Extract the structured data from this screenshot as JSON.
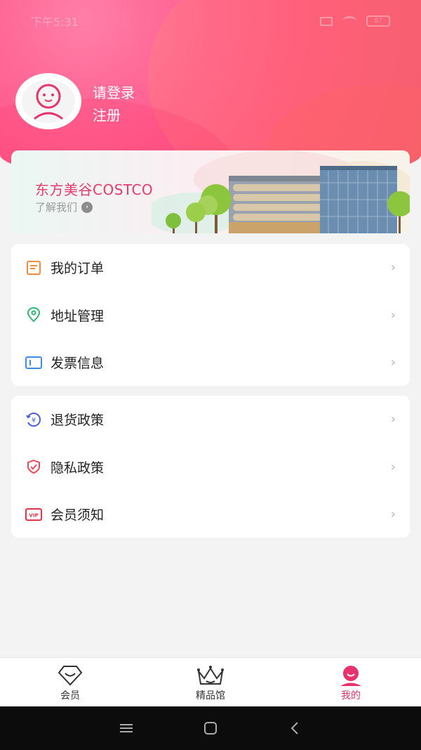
{
  "status_bar": {
    "time": "下午5:31",
    "battery": "87"
  },
  "profile": {
    "login_label": "请登录",
    "register_label": "注册"
  },
  "banner": {
    "title": "东方美谷COSTCO",
    "subtitle": "了解我们"
  },
  "menu_group_1": [
    {
      "label": "我的订单",
      "icon": "order-list-icon",
      "color": "#f08a3c"
    },
    {
      "label": "地址管理",
      "icon": "location-pin-icon",
      "color": "#2fb872"
    },
    {
      "label": "发票信息",
      "icon": "invoice-ticket-icon",
      "color": "#3a8ee6"
    }
  ],
  "menu_group_2": [
    {
      "label": "退货政策",
      "icon": "refund-yen-icon",
      "color": "#4b5ee0"
    },
    {
      "label": "隐私政策",
      "icon": "shield-check-icon",
      "color": "#ef4a5a"
    },
    {
      "label": "会员须知",
      "icon": "vip-badge-icon",
      "color": "#e8324c"
    }
  ],
  "tab_bar": [
    {
      "label": "会员",
      "icon": "diamond-heart-icon",
      "active": false
    },
    {
      "label": "精品馆",
      "icon": "crown-icon",
      "active": false
    },
    {
      "label": "我的",
      "icon": "profile-face-icon",
      "active": true
    }
  ],
  "colors": {
    "brand_pink": "#e8326c",
    "header_gradient": "#ff5c8e"
  }
}
